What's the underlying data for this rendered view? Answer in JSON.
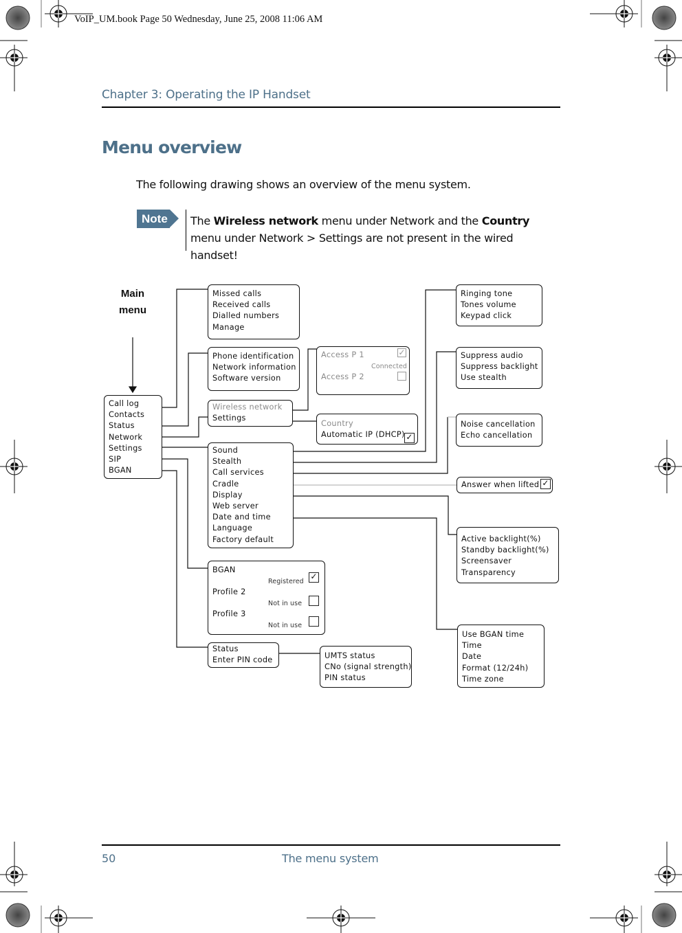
{
  "print_header": "VoIP_UM.book  Page 50  Wednesday, June 25, 2008  11:06 AM",
  "chapter_title": "Chapter 3:  Operating the IP Handset",
  "section_title": "Menu overview",
  "intro_text": "The following drawing shows an overview of the menu system.",
  "note": {
    "badge": "Note",
    "parts": [
      "The ",
      "Wireless network",
      " menu under Network and the ",
      "Country",
      " menu under Network > Settings are not present in the wired handset!"
    ]
  },
  "diagram": {
    "main_label": [
      "Main",
      "menu"
    ],
    "main_menu": [
      "Call log",
      "Contacts",
      "Status",
      "Network",
      "Settings",
      "SIP",
      "BGAN"
    ],
    "call_log": [
      "Missed calls",
      "Received calls",
      "Dialled numbers",
      "Manage"
    ],
    "status": [
      "Phone identification",
      "Network information",
      "Software version"
    ],
    "network": [
      "Wireless network",
      "Settings"
    ],
    "access_points": {
      "items": [
        "Access P 1",
        "Access P 2"
      ],
      "state_label": "Connected",
      "checked": [
        true,
        false
      ]
    },
    "network_settings": {
      "items": [
        "Country",
        "Automatic IP (DHCP)"
      ],
      "dhcp_checked": true
    },
    "settings": [
      "Sound",
      "Stealth",
      "Call services",
      "Cradle",
      "Display",
      "Web server",
      "Date and time",
      "Language",
      "Factory default"
    ],
    "sound": [
      "Ringing tone",
      "Tones volume",
      "Keypad click"
    ],
    "stealth": [
      "Suppress audio",
      "Suppress backlight",
      "Use stealth"
    ],
    "call_services": [
      "Noise cancellation",
      "Echo cancellation"
    ],
    "cradle": {
      "label": "Answer when lifted",
      "checked": true
    },
    "display": [
      "Active backlight(%)",
      "Standby backlight(%)",
      "Screensaver",
      "Transparency"
    ],
    "date_time": [
      "Use BGAN time",
      "Time",
      "Date",
      "Format (12/24h)",
      "Time zone"
    ],
    "sip": [
      {
        "label": "BGAN",
        "state": "Registered",
        "checked": true
      },
      {
        "label": "Profile 2",
        "state": "Not in use",
        "checked": false
      },
      {
        "label": "Profile 3",
        "state": "Not in use",
        "checked": false
      }
    ],
    "bgan": [
      "Status",
      "Enter PIN code"
    ],
    "bgan_status": [
      "UMTS status",
      "CNo (signal strength)",
      "PIN status"
    ]
  },
  "footer": {
    "page_number": "50",
    "section": "The menu system"
  },
  "colors": {
    "heading_blue": "#4d7089",
    "note_badge": "#4f7591"
  }
}
